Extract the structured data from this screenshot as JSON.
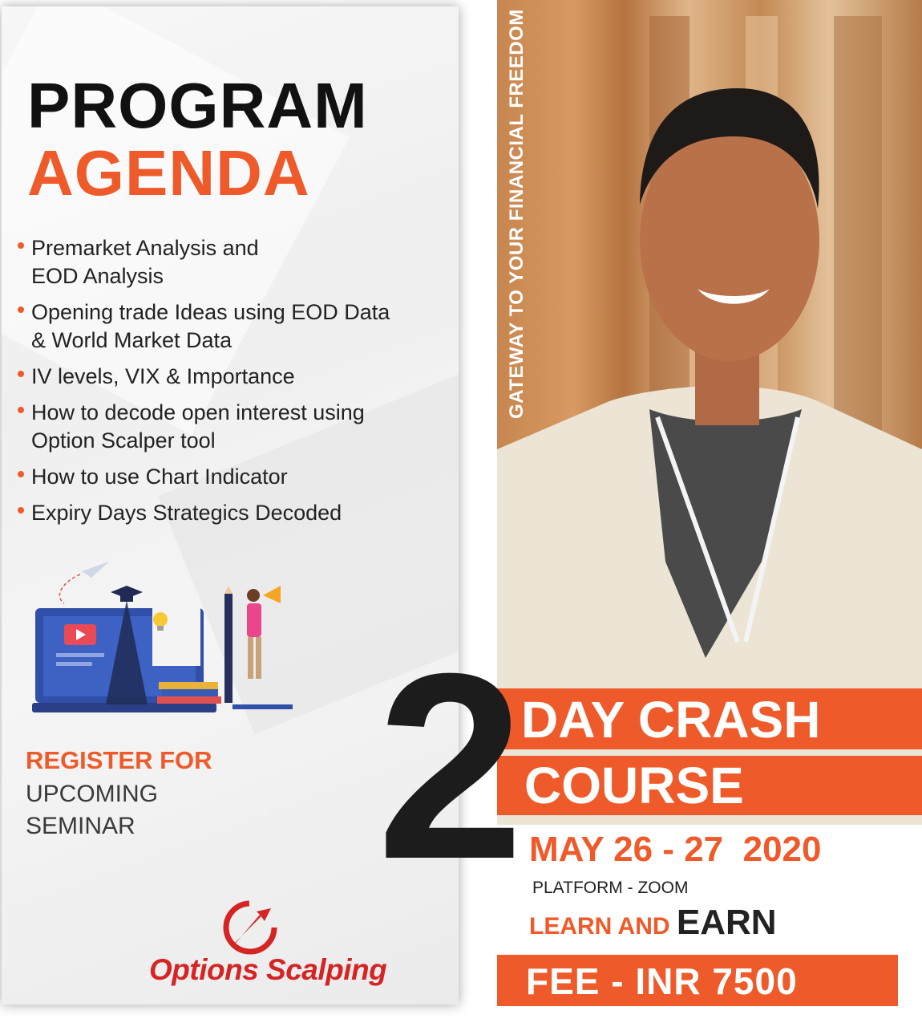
{
  "agenda_card": {
    "title_line1": "PROGRAM",
    "title_line2": "AGENDA",
    "items": [
      {
        "line1": "Premarket Analysis and",
        "line2": "EOD Analysis"
      },
      {
        "line1": "Opening trade Ideas using EOD Data",
        "line2": "& World Market Data"
      },
      {
        "line1": "IV levels, VIX & Importance",
        "line2": ""
      },
      {
        "line1": "How to decode open interest using",
        "line2": "Option Scalper tool"
      },
      {
        "line1": "How to use Chart Indicator",
        "line2": ""
      },
      {
        "line1": "Expiry Days Strategics Decoded",
        "line2": ""
      }
    ],
    "register_line1": "REGISTER FOR",
    "register_line2": "UPCOMING",
    "register_line3": "SEMINAR",
    "brand": "Options Scalping"
  },
  "photo_panel": {
    "tagline": "GATEWAY TO YOUR FINANCIAL FREEDOM"
  },
  "course": {
    "number": "2",
    "line1": "DAY CRASH",
    "line2": "COURSE",
    "dates": "MAY 26 - 27  2020",
    "platform": "PLATFORM - ZOOM",
    "learn_part1": "LEARN AND ",
    "learn_part2": "EARN",
    "fee": "FEE - INR 7500"
  },
  "colors": {
    "accent": "#ef5a2a",
    "dark": "#1c1c1c",
    "brand_red": "#d42424"
  },
  "icons": [
    "options-scalping-logo-icon",
    "paper-plane-icon",
    "graduation-cap-icon",
    "light-bulb-icon",
    "megaphone-icon",
    "play-video-icon",
    "books-icon",
    "pencil-icon"
  ]
}
